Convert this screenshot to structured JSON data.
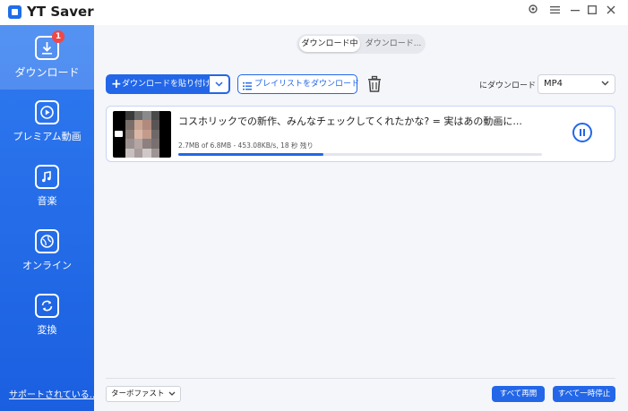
{
  "app": {
    "title": "YT Saver"
  },
  "sidebar": {
    "items": [
      {
        "label": "ダウンロード",
        "badge": "1",
        "icon": "download-icon"
      },
      {
        "label": "プレミアム動画",
        "icon": "play-icon"
      },
      {
        "label": "音楽",
        "icon": "music-note-icon"
      },
      {
        "label": "オンライン",
        "icon": "globe-icon"
      },
      {
        "label": "変換",
        "icon": "convert-icon"
      }
    ],
    "support_link": "サポートされている..."
  },
  "tabs": {
    "downloading": "ダウンロード中",
    "downloaded": "ダウンロード..."
  },
  "toolbar": {
    "paste_label": "ダウンロードを貼り付け",
    "playlist_label": "プレイリストをダウンロード",
    "download_to_label": "にダウンロード",
    "format_value": "MP4"
  },
  "download_item": {
    "title": "コスホリックでの新作、みんなチェックしてくれたかな? = 実はあの動画に...",
    "stats": "2.7MB of 6.8MB -  453.08KB/s, 18 秒 残り",
    "progress_fraction": 0.4
  },
  "footer": {
    "speed_value": "ターボファスト",
    "resume_all": "すべて再開",
    "pause_all": "すべて一時停止"
  },
  "colors": {
    "accent": "#2367e8",
    "sidebar": "#2f7af0",
    "badge": "#f04747"
  }
}
